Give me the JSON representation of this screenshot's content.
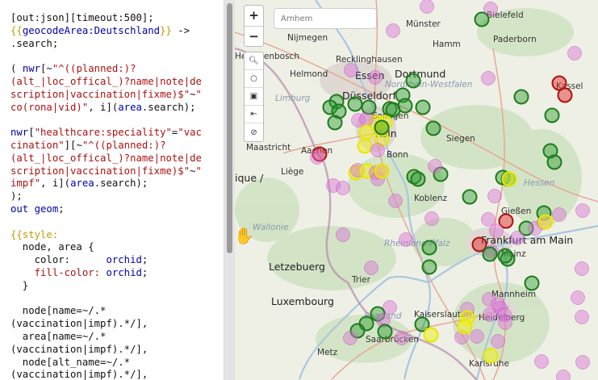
{
  "editor": {
    "lines": [
      [
        {
          "t": "[out:json][timeout:500];",
          "c": ""
        }
      ],
      [
        {
          "t": "{{",
          "c": "tpl"
        },
        {
          "t": "geocodeArea:Deutschland",
          "c": "kw"
        },
        {
          "t": "}}",
          "c": "tpl"
        },
        {
          "t": " ->",
          "c": ""
        }
      ],
      [
        {
          "t": ".search;",
          "c": ""
        }
      ],
      [
        {
          "t": "",
          "c": ""
        }
      ],
      [
        {
          "t": "( ",
          "c": ""
        },
        {
          "t": "nwr",
          "c": "kw"
        },
        {
          "t": "[~",
          "c": ""
        },
        {
          "t": "\"^((planned:)?",
          "c": "str"
        }
      ],
      [
        {
          "t": "(alt_|loc_offical_)?name|note|de",
          "c": "str"
        }
      ],
      [
        {
          "t": "scription|vaccination|fixme)$\"",
          "c": "str"
        },
        {
          "t": "~",
          "c": ""
        },
        {
          "t": "\"",
          "c": "str"
        }
      ],
      [
        {
          "t": "co(rona|vid)\"",
          "c": "str"
        },
        {
          "t": ", i](",
          "c": ""
        },
        {
          "t": "area",
          "c": "kw"
        },
        {
          "t": ".search);",
          "c": ""
        }
      ],
      [
        {
          "t": "",
          "c": ""
        }
      ],
      [
        {
          "t": "nwr",
          "c": "kw"
        },
        {
          "t": "[",
          "c": ""
        },
        {
          "t": "\"healthcare:speciality\"",
          "c": "str"
        },
        {
          "t": "=",
          "c": ""
        },
        {
          "t": "\"vac",
          "c": "str"
        }
      ],
      [
        {
          "t": "cination\"",
          "c": "str"
        },
        {
          "t": "][~",
          "c": ""
        },
        {
          "t": "\"^((planned:)?",
          "c": "str"
        }
      ],
      [
        {
          "t": "(alt_|loc_offical_)?name|note|de",
          "c": "str"
        }
      ],
      [
        {
          "t": "scription|vaccination|fixme)$\"",
          "c": "str"
        },
        {
          "t": "~",
          "c": ""
        },
        {
          "t": "\"",
          "c": "str"
        }
      ],
      [
        {
          "t": "impf\"",
          "c": "str"
        },
        {
          "t": ", i](",
          "c": ""
        },
        {
          "t": "area",
          "c": "kw"
        },
        {
          "t": ".search);",
          "c": ""
        }
      ],
      [
        {
          "t": ");",
          "c": ""
        }
      ],
      [
        {
          "t": "out ",
          "c": "kw"
        },
        {
          "t": "geom",
          "c": "kw"
        },
        {
          "t": ";",
          "c": ""
        }
      ],
      [
        {
          "t": "",
          "c": ""
        }
      ],
      [
        {
          "t": "{{style:",
          "c": "tpl"
        }
      ],
      [
        {
          "t": "  node, area {",
          "c": ""
        }
      ],
      [
        {
          "t": "    color:      ",
          "c": ""
        },
        {
          "t": "orchid",
          "c": "val"
        },
        {
          "t": ";",
          "c": ""
        }
      ],
      [
        {
          "t": "    fill-color: ",
          "c": "prop"
        },
        {
          "t": "orchid",
          "c": "val"
        },
        {
          "t": ";",
          "c": ""
        }
      ],
      [
        {
          "t": "  }",
          "c": ""
        }
      ],
      [
        {
          "t": "",
          "c": ""
        }
      ],
      [
        {
          "t": "  node[name=~/.*",
          "c": ""
        }
      ],
      [
        {
          "t": "(vaccination|impf).*/],",
          "c": ""
        }
      ],
      [
        {
          "t": "  area[name=~/.*",
          "c": ""
        }
      ],
      [
        {
          "t": "(vaccination|impf).*/],",
          "c": ""
        }
      ],
      [
        {
          "t": "  node[alt_name=~/.*",
          "c": ""
        }
      ],
      [
        {
          "t": "(vaccination|impf).*/],",
          "c": ""
        }
      ]
    ]
  },
  "map": {
    "search_placeholder": "Arnhem",
    "zoom_in": "+",
    "zoom_out": "−",
    "cities": [
      {
        "name": "Bielefeld"
      },
      {
        "name": "Münster"
      },
      {
        "name": "Nijmegen"
      },
      {
        "name": "Hamm"
      },
      {
        "name": "Paderborn"
      },
      {
        "name": "Hertogenbosch"
      },
      {
        "name": "Recklinghausen"
      },
      {
        "name": "Helmond"
      },
      {
        "name": "Essen"
      },
      {
        "name": "Dortmund"
      },
      {
        "name": "Düsseldorf"
      },
      {
        "name": "Kassel"
      },
      {
        "name": "Limburg"
      },
      {
        "name": "Maastricht"
      },
      {
        "name": "Aachen"
      },
      {
        "name": "Köln"
      },
      {
        "name": "Bonn"
      },
      {
        "name": "Siegen"
      },
      {
        "name": "Liège"
      },
      {
        "name": "Koblenz"
      },
      {
        "name": "Frankfurt am Main"
      },
      {
        "name": "Letzebuerg"
      },
      {
        "name": "Trier"
      },
      {
        "name": "Luxembourg"
      },
      {
        "name": "Mannheim"
      },
      {
        "name": "Kaiserslautern"
      },
      {
        "name": "Heidelberg"
      },
      {
        "name": "Saarbrücken"
      },
      {
        "name": "Metz"
      },
      {
        "name": "Karlsruhe"
      },
      {
        "name": "Mainz"
      },
      {
        "name": "Solingen"
      },
      {
        "name": "Gießen"
      }
    ],
    "regions": [
      {
        "name": "Nordrhein-Westfalen"
      },
      {
        "name": "Hessen"
      },
      {
        "name": "Rheinland-Pfalz"
      },
      {
        "name": "Wallonie"
      },
      {
        "name": "Saarland"
      },
      {
        "name": "ique /"
      }
    ],
    "colors": {
      "orchid": "#da70d6",
      "green": "#2e9d2e",
      "yellow": "#eeee22",
      "red": "#e02020",
      "orange": "#f0a020"
    }
  }
}
